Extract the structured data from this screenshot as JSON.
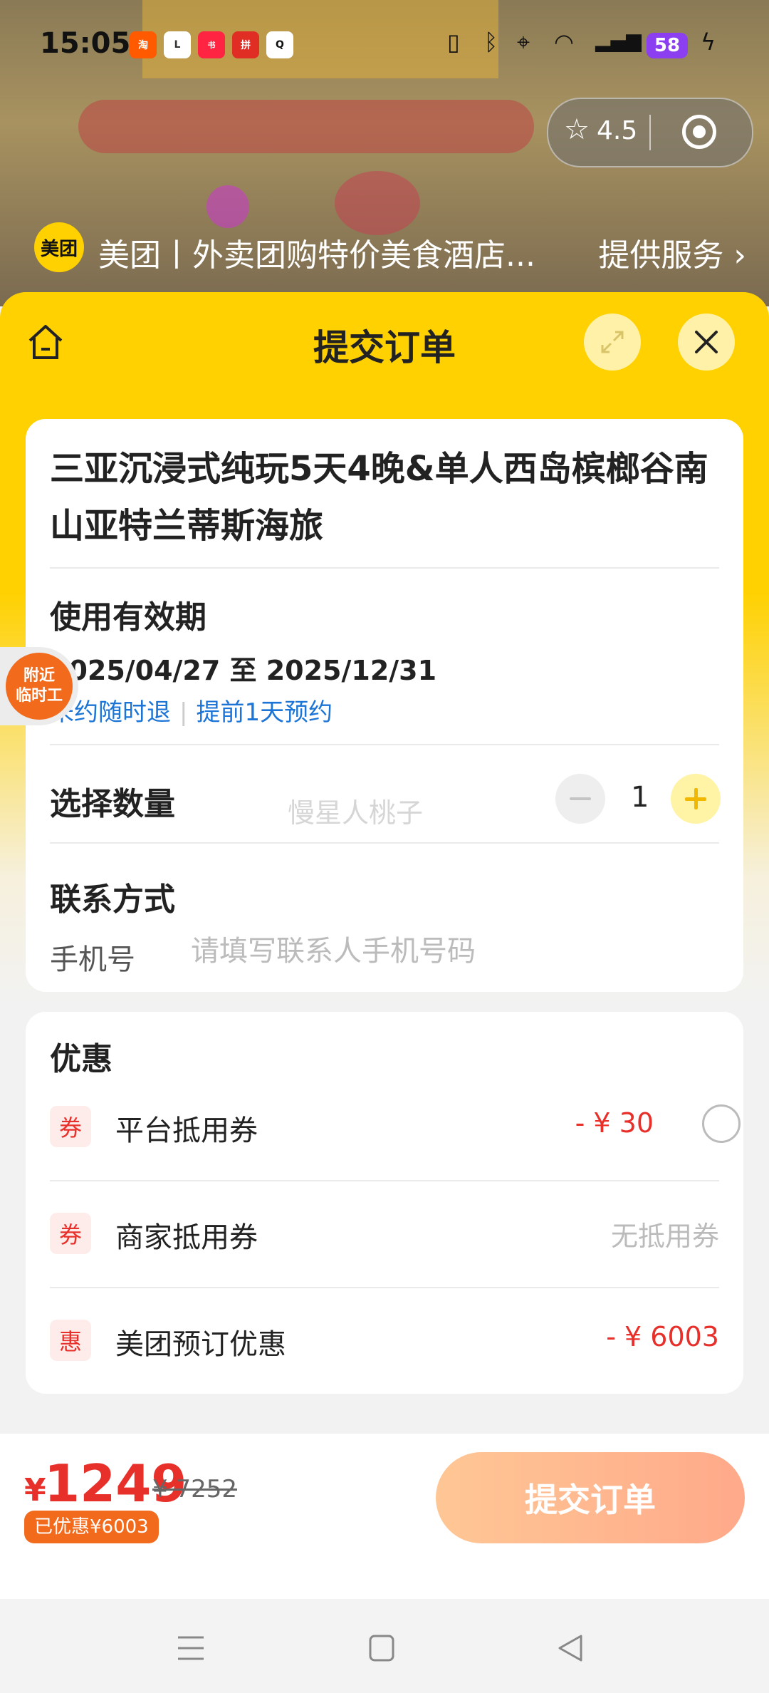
{
  "status_bar": {
    "time": "15:05",
    "apps": [
      "taobao-icon",
      "lofter-icon",
      "xiaohongshu-icon",
      "pinduoduo-icon",
      "qq-icon"
    ],
    "battery": "58"
  },
  "capsule": {
    "rating": "4.5"
  },
  "provider": {
    "logo": "美团",
    "name": "美团丨外卖团购特价美食酒店...",
    "link": "提供服务"
  },
  "sheet": {
    "title": "提交订单"
  },
  "product": {
    "title": "三亚沉浸式纯玩5天4晚&单人西岛槟榔谷南山亚特兰蒂斯海旅",
    "validity_label": "使用有效期",
    "validity_range": "2025/04/27 至 2025/12/31",
    "tags": [
      "未约随时退",
      "提前1天预约"
    ]
  },
  "quantity": {
    "label": "选择数量",
    "value": "1"
  },
  "watermark": "慢星人桃子",
  "contact": {
    "label": "联系方式",
    "phone_label": "手机号",
    "phone_placeholder": "请填写联系人手机号码"
  },
  "discounts": {
    "title": "优惠",
    "items": [
      {
        "tag": "券",
        "name": "平台抵用券",
        "value": "- ¥ 30"
      },
      {
        "tag": "券",
        "name": "商家抵用券",
        "value": "无抵用券"
      },
      {
        "tag": "惠",
        "name": "美团预订优惠",
        "value": "- ¥ 6003"
      }
    ]
  },
  "float_badge": {
    "line1": "附近",
    "line2": "临时工"
  },
  "footer": {
    "currency": "¥",
    "price": "1249",
    "original_price": "¥ 7252",
    "saved": "已优惠¥6003",
    "submit": "提交订单"
  },
  "colors": {
    "brand_yellow": "#ffd100",
    "price_red": "#e8302b",
    "link_blue": "#1b74d6",
    "orange": "#f26a1b"
  }
}
